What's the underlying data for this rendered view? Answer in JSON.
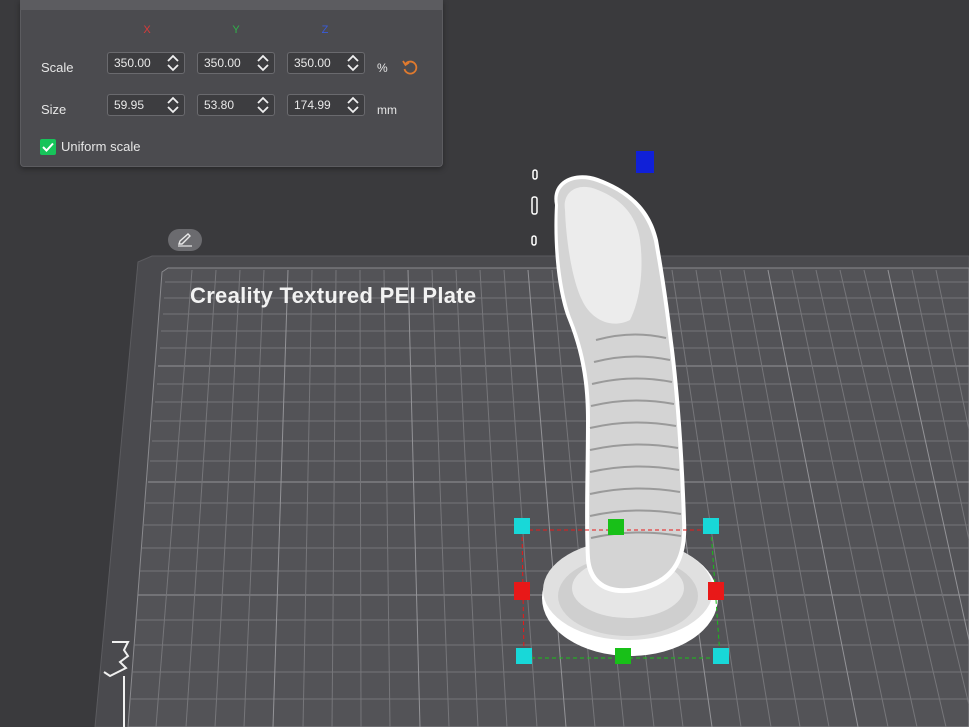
{
  "scale_panel": {
    "axes": {
      "x": {
        "label": "X",
        "color": "#d83a3a"
      },
      "y": {
        "label": "Y",
        "color": "#2fb34a"
      },
      "z": {
        "label": "Z",
        "color": "#3a5bd8"
      }
    },
    "scale": {
      "label": "Scale",
      "x": "350.00",
      "y": "350.00",
      "z": "350.00",
      "unit": "%"
    },
    "size": {
      "label": "Size",
      "x": "59.95",
      "y": "53.80",
      "z": "174.99",
      "unit": "mm"
    },
    "uniform_scale": {
      "label": "Uniform scale",
      "checked": true
    },
    "reset_icon": "reset-rotate-icon",
    "accent_color": "#e07a2e",
    "check_color": "#17c45a"
  },
  "build_plate": {
    "title": "Creality Textured PEI Plate",
    "edit_icon": "pencil-icon"
  },
  "gizmo": {
    "handle_colors": {
      "x": "#e81818",
      "y": "#18c018",
      "corner": "#18d8d8",
      "z": "#1020d8"
    }
  }
}
